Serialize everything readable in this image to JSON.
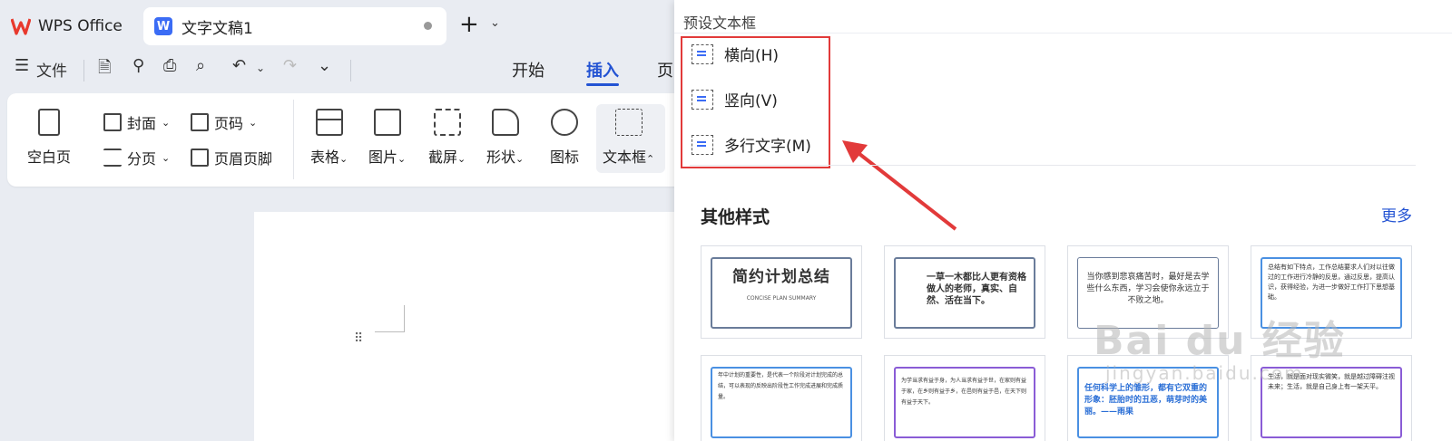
{
  "tabs": {
    "app_label": "WPS Office",
    "doc_label": "文字文稿1",
    "doc_logo": "W",
    "plus": "+",
    "caret": "⌄"
  },
  "toolbar": {
    "file_menu": "文件",
    "menu_start": "开始",
    "menu_insert": "插入",
    "menu_page": "页"
  },
  "ribbon": {
    "blank_page": "空白页",
    "cover": "封面",
    "page_number": "页码",
    "page_break": "分页",
    "header_footer": "页眉页脚",
    "table": "表格",
    "picture": "图片",
    "screenshot": "截屏",
    "shape": "形状",
    "icon": "图标",
    "textbox": "文本框"
  },
  "panel": {
    "title": "预设文本框",
    "items": [
      {
        "label": "横向(H)"
      },
      {
        "label": "竖向(V)"
      },
      {
        "label": "多行文字(M)"
      }
    ],
    "other_styles": "其他样式",
    "more": "更多",
    "thumbnails": [
      {
        "text": "简约计划总结",
        "sub": "CONCISE PLAN SUMMARY"
      },
      {
        "text": "一草一木都比人更有资格做人的老师，真实、自然、活在当下。"
      },
      {
        "text": "当你感到悲哀痛苦时，最好是去学些什么东西，学习会使你永远立于不败之地。"
      },
      {
        "text": "总结有如下特点，工作总结要求人们对以往做过的工作进行冷静的反思，通过反思，提高认识，获得经验，为进一步做好工作打下思想基础。"
      },
      {
        "text": "年中计划的重要性，是代表一个阶段对计划完成的总结，可以表现的反映出阶段性工作完成进展和完成质量。"
      },
      {
        "text": "为学当求有益于身，为人当求有益于世，在家则有益于家，在乡则有益于乡，在邑则有益于邑，在天下则有益于天下。"
      },
      {
        "text": "任何科学上的雏形，都有它双重的形象：胚胎时的丑恶，萌芽时的美丽。——雨果"
      },
      {
        "text": "生活，就是面对现实微笑，就是越过障碍注视未来；生活，就是自己身上有一架天平。"
      }
    ]
  },
  "watermark": {
    "main": "Bai du 经验",
    "sub": "jingyan.baidu.com"
  }
}
